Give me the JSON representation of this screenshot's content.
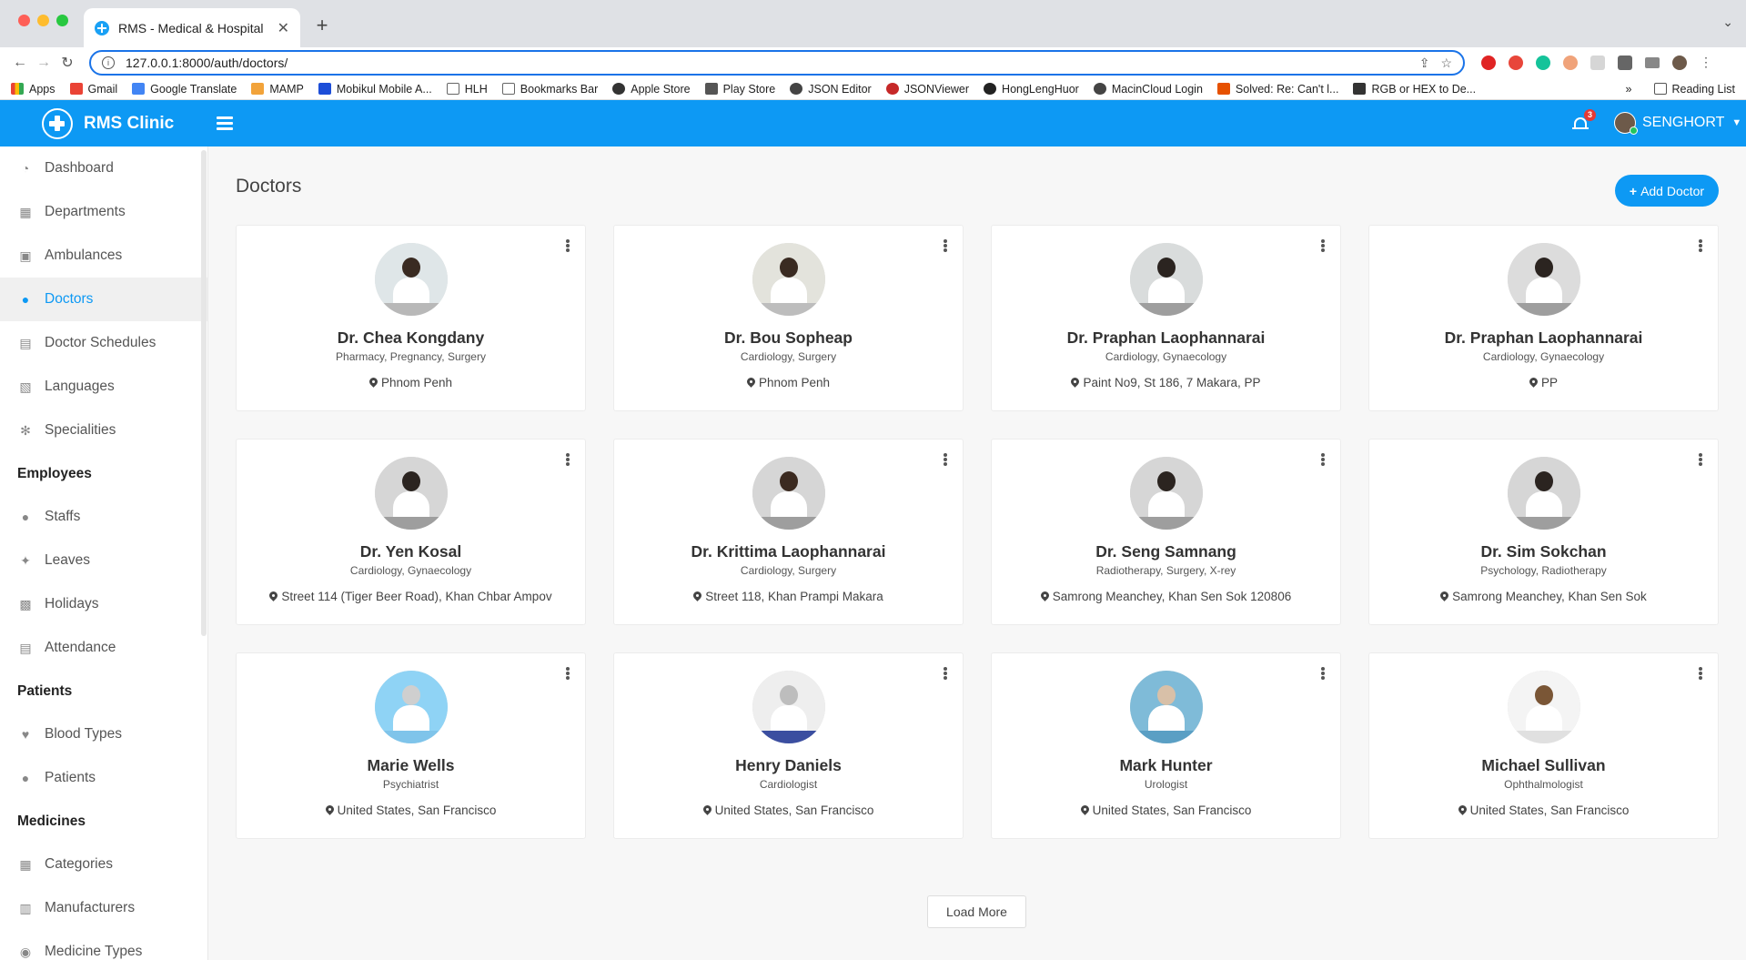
{
  "browser": {
    "tab_title": "RMS - Medical & Hospital",
    "url": "127.0.0.1:8000/auth/doctors/",
    "bookmarks": [
      "Apps",
      "Gmail",
      "Google Translate",
      "MAMP",
      "Mobikul Mobile A...",
      "HLH",
      "Bookmarks Bar",
      "Apple Store",
      "Play Store",
      "JSON Editor",
      "JSONViewer",
      "HongLengHuor",
      "MacinCloud Login",
      "Solved: Re: Can't l...",
      "RGB or HEX to De..."
    ],
    "reading_list": "Reading List",
    "more_bookmarks": "»"
  },
  "header": {
    "brand": "RMS Clinic",
    "notification_count": "3",
    "username": "SENGHORT",
    "accent_color": "#0d99f4"
  },
  "sidebar": {
    "items": [
      {
        "label": "Dashboard",
        "icon": "dashboard-icon"
      },
      {
        "label": "Departments",
        "icon": "building-icon"
      },
      {
        "label": "Ambulances",
        "icon": "bus-icon"
      },
      {
        "label": "Doctors",
        "icon": "user-md-icon",
        "active": true
      },
      {
        "label": "Doctor Schedules",
        "icon": "calendar-check-icon"
      },
      {
        "label": "Languages",
        "icon": "language-icon"
      },
      {
        "label": "Specialities",
        "icon": "snowflake-icon"
      }
    ],
    "employees_heading": "Employees",
    "employees": [
      {
        "label": "Staffs",
        "icon": "users-icon"
      },
      {
        "label": "Leaves",
        "icon": "walking-icon"
      },
      {
        "label": "Holidays",
        "icon": "gift-icon"
      },
      {
        "label": "Attendance",
        "icon": "calendar-icon"
      }
    ],
    "patients_heading": "Patients",
    "patients": [
      {
        "label": "Blood Types",
        "icon": "heartbeat-icon"
      },
      {
        "label": "Patients",
        "icon": "users-icon"
      }
    ],
    "medicines_heading": "Medicines",
    "medicines": [
      {
        "label": "Categories",
        "icon": "th-large-icon"
      },
      {
        "label": "Manufacturers",
        "icon": "university-icon"
      },
      {
        "label": "Medicine Types",
        "icon": "pills-icon"
      }
    ]
  },
  "main": {
    "title": "Doctors",
    "add_button": "Add Doctor",
    "load_more": "Load More"
  },
  "doctors": [
    {
      "name": "Dr. Chea Kongdany",
      "specialties": "Pharmacy, Pregnancy, Surgery",
      "location": "Phnom Penh"
    },
    {
      "name": "Dr. Bou Sopheap",
      "specialties": "Cardiology, Surgery",
      "location": "Phnom Penh"
    },
    {
      "name": "Dr. Praphan Laophannarai",
      "specialties": "Cardiology, Gynaecology",
      "location": "Paint No9, St 186, 7 Makara, PP"
    },
    {
      "name": "Dr. Praphan Laophannarai",
      "specialties": "Cardiology, Gynaecology",
      "location": "PP"
    },
    {
      "name": "Dr. Yen Kosal",
      "specialties": "Cardiology, Gynaecology",
      "location": "Street 114 (Tiger Beer Road), Khan Chbar Ampov"
    },
    {
      "name": "Dr. Krittima Laophannarai",
      "specialties": "Cardiology, Surgery",
      "location": "Street 118, Khan Prampi Makara"
    },
    {
      "name": "Dr. Seng Samnang",
      "specialties": "Radiotherapy, Surgery, X-rey",
      "location": "Samrong Meanchey, Khan Sen Sok 120806"
    },
    {
      "name": "Dr. Sim Sokchan",
      "specialties": "Psychology, Radiotherapy",
      "location": "Samrong Meanchey, Khan Sen Sok"
    },
    {
      "name": "Marie Wells",
      "specialties": "Psychiatrist",
      "location": "United States, San Francisco"
    },
    {
      "name": "Henry Daniels",
      "specialties": "Cardiologist",
      "location": "United States, San Francisco"
    },
    {
      "name": "Mark Hunter",
      "specialties": "Urologist",
      "location": "United States, San Francisco"
    },
    {
      "name": "Michael Sullivan",
      "specialties": "Ophthalmologist",
      "location": "United States, San Francisco"
    }
  ]
}
